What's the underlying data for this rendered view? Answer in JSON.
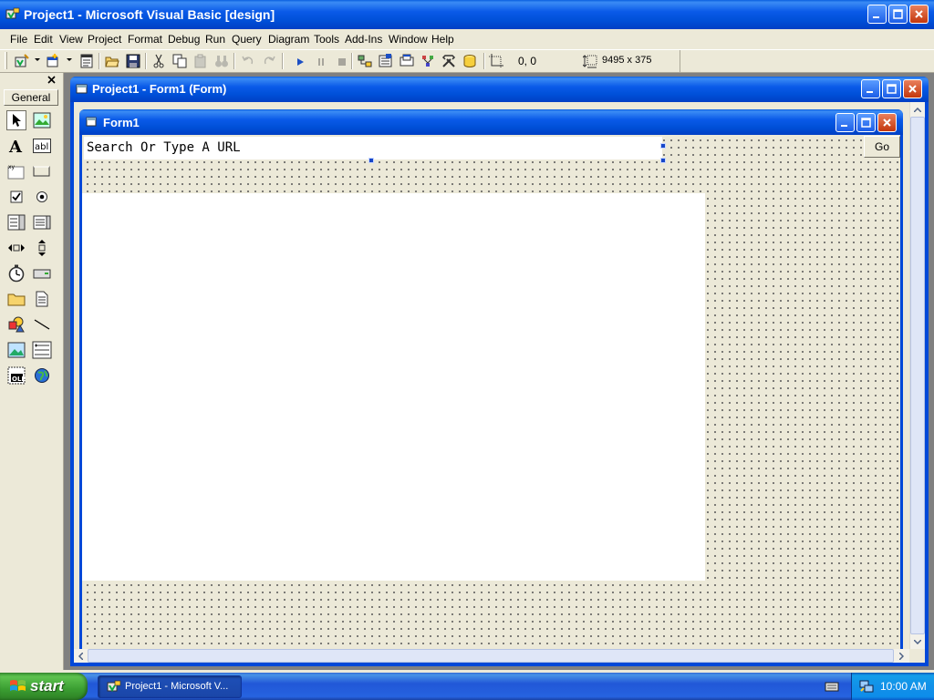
{
  "app": {
    "title": "Project1 - Microsoft Visual Basic [design]"
  },
  "menu": [
    "File",
    "Edit",
    "View",
    "Project",
    "Format",
    "Debug",
    "Run",
    "Query",
    "Diagram",
    "Tools",
    "Add-Ins",
    "Window",
    "Help"
  ],
  "toolbar": {
    "position": "0, 0",
    "size": "9495 x 375"
  },
  "toolbox": {
    "tab_label": "General"
  },
  "mdi_window": {
    "title": "Project1 - Form1 (Form)"
  },
  "form": {
    "title": "Form1",
    "url_text": "Search Or Type A URL",
    "go_label": "Go"
  },
  "taskbar": {
    "start_label": "start",
    "task_label": "Project1 - Microsoft V...",
    "clock": "10:00 AM"
  },
  "colors": {
    "titlebar": "#0054e3",
    "taskbar": "#245edb",
    "start": "#3c9a34",
    "face": "#ece9d8"
  }
}
